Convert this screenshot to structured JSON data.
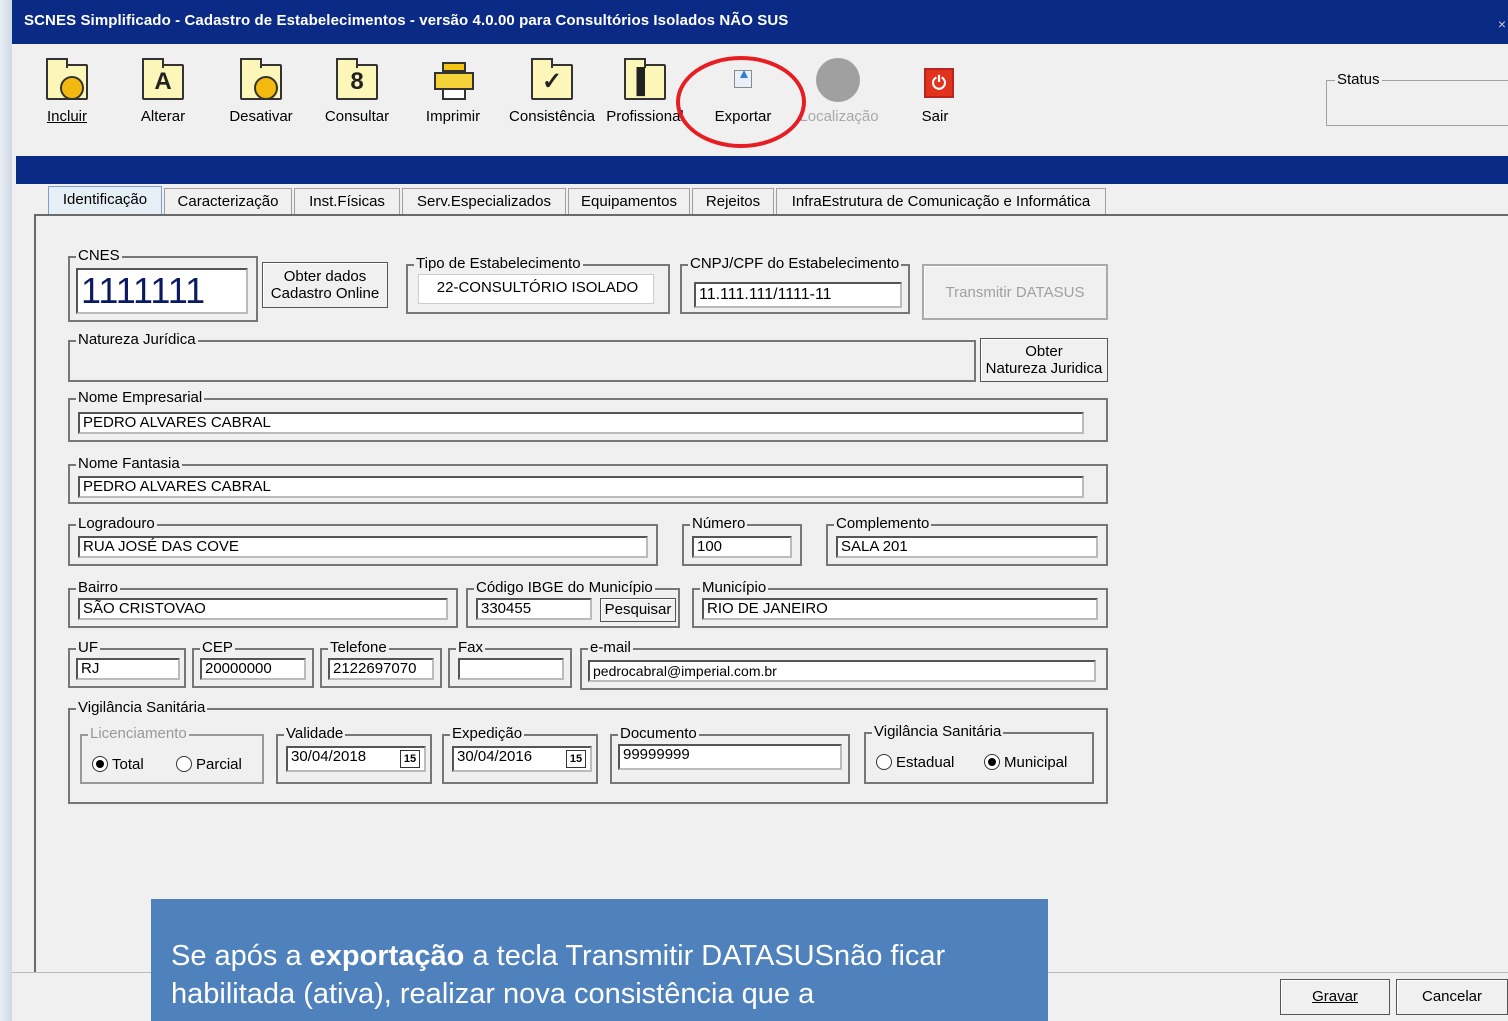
{
  "window": {
    "title": "SCNES Simplificado - Cadastro de Estabelecimentos - versão 4.0.00 para Consultórios Isolados NÃO SUS",
    "close_glyph": "×"
  },
  "toolbar": {
    "buttons": [
      {
        "label": "Incluir",
        "icon": "include-icon"
      },
      {
        "label": "Alterar",
        "icon": "edit-icon"
      },
      {
        "label": "Desativar",
        "icon": "deactivate-icon"
      },
      {
        "label": "Consultar",
        "icon": "search-icon"
      },
      {
        "label": "Imprimir",
        "icon": "printer-icon"
      },
      {
        "label": "Consistência",
        "icon": "check-icon"
      },
      {
        "label": "Profissional",
        "icon": "professional-icon"
      },
      {
        "label": "Exportar",
        "icon": "export-icon"
      },
      {
        "label": "Localização",
        "icon": "location-icon"
      },
      {
        "label": "Sair",
        "icon": "exit-icon"
      }
    ],
    "status_label": "Status"
  },
  "tabs": [
    "Identificação",
    "Caracterização",
    "Inst.Físicas",
    "Serv.Especializados",
    "Equipamentos",
    "Rejeitos",
    "InfraEstrutura de Comunicação e Informática"
  ],
  "form": {
    "cnes": {
      "label": "CNES",
      "value": "1111111"
    },
    "obter_dados_btn": [
      "Obter dados",
      "Cadastro Online"
    ],
    "tipo": {
      "label": "Tipo de Estabelecimento",
      "value": "22-CONSULTÓRIO ISOLADO"
    },
    "cnpj": {
      "label": "CNPJ/CPF do Estabelecimento",
      "value": "11.111.111/1111-11"
    },
    "transmitir_btn": "Transmitir DATASUS",
    "natureza": {
      "label": "Natureza Jurídica",
      "value": ""
    },
    "obter_natureza_btn": [
      "Obter",
      "Natureza Juridica"
    ],
    "nome_empresarial": {
      "label": "Nome Empresarial",
      "value": "PEDRO ALVARES CABRAL"
    },
    "nome_fantasia": {
      "label": "Nome Fantasia",
      "value": "PEDRO ALVARES CABRAL"
    },
    "logradouro": {
      "label": "Logradouro",
      "value": "RUA JOSÉ DAS COVE"
    },
    "numero": {
      "label": "Número",
      "value": "100"
    },
    "complemento": {
      "label": "Complemento",
      "value": "SALA 201"
    },
    "bairro": {
      "label": "Bairro",
      "value": "SÃO CRISTOVAO"
    },
    "ibge": {
      "label": "Código IBGE do Município",
      "value": "330455"
    },
    "pesquisar_btn": "Pesquisar",
    "municipio": {
      "label": "Município",
      "value": "RIO DE JANEIRO"
    },
    "uf": {
      "label": "UF",
      "value": "RJ"
    },
    "cep": {
      "label": "CEP",
      "value": "20000000"
    },
    "telefone": {
      "label": "Telefone",
      "value": "2122697070"
    },
    "fax": {
      "label": "Fax",
      "value": ""
    },
    "email": {
      "label": "e-mail",
      "value": "pedrocabral@imperial.com.br"
    },
    "vigilancia": {
      "label": "Vigilância Sanitária",
      "licenciamento": {
        "label": "Licenciamento",
        "options": [
          "Total",
          "Parcial"
        ],
        "selected": "Total"
      },
      "validade": {
        "label": "Validade",
        "value": "30/04/2018"
      },
      "expedicao": {
        "label": "Expedição",
        "value": "30/04/2016"
      },
      "calendar_glyph": "15",
      "documento": {
        "label": "Documento",
        "value": "99999999"
      },
      "esfera": {
        "label": "Vigilância Sanitária",
        "options": [
          "Estadual",
          "Municipal"
        ],
        "selected": "Municipal"
      }
    }
  },
  "footer": {
    "gravar": "Gravar",
    "cancelar": "Cancelar"
  },
  "overlay": {
    "pre": "Se após a ",
    "bold": "exportação",
    "post": " a tecla Transmitir DATASUSnão ficar habilitada (ativa), realizar nova consistência que a"
  },
  "colors": {
    "titlebar": "#0a2a85",
    "highlight_ellipse": "#e61e24",
    "overlay": "#4f81bd"
  }
}
